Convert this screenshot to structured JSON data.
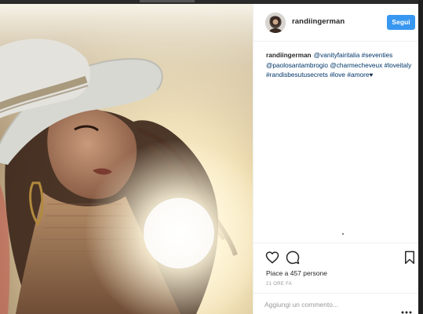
{
  "post": {
    "username": "randiingerman",
    "follow_label": "Segui",
    "caption": {
      "author": "randiingerman",
      "tags": [
        "@vanityfairitalia",
        "#seventies",
        "@paolosantambrogio",
        "@charmecheveux",
        "#loveitaly",
        "#randisbesutusecrets",
        "#love",
        "#amore"
      ],
      "heart": "♥"
    },
    "likes_text": "Piace a 457 persone",
    "time_text": "21 ORE FA",
    "comment_placeholder": "Aggiungi un commento...",
    "icons": {
      "like": "heart-outline-icon",
      "comment": "speech-bubble-icon",
      "save": "bookmark-icon",
      "more": "ellipsis-icon"
    }
  },
  "colors": {
    "follow_button": "#3897f0",
    "hashtag": "#003569",
    "heart": "#0b2a4a",
    "muted_text": "#999999",
    "divider": "#efefef"
  }
}
